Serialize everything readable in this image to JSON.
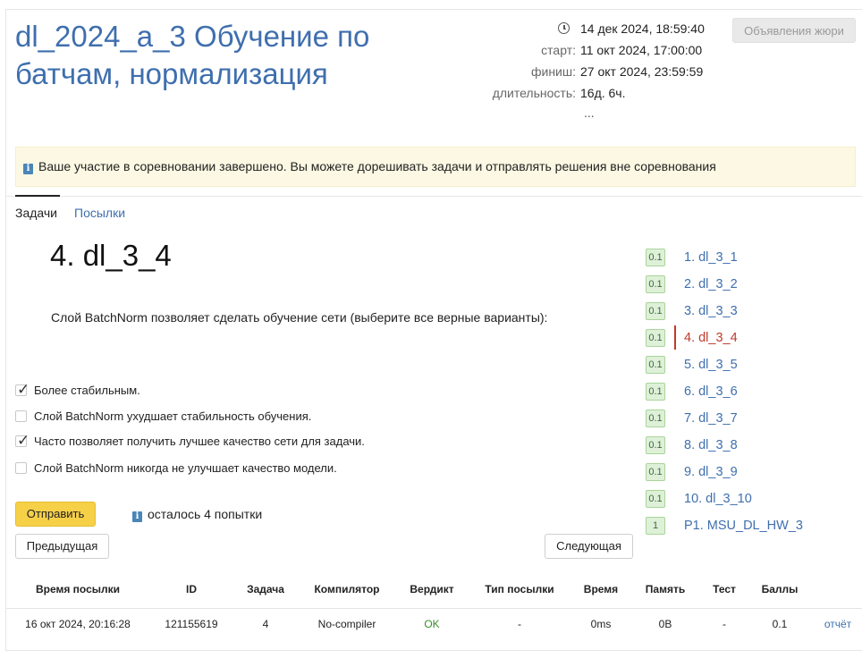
{
  "contest": {
    "title": "dl_2024_a_3 Обучение по батчам, нормализация",
    "current_time": "14 дек 2024, 18:59:40",
    "start_label": "старт:",
    "start_value": "11 окт 2024, 17:00:00",
    "finish_label": "финиш:",
    "finish_value": "27 окт 2024, 23:59:59",
    "duration_label": "длительность:",
    "duration_value": "16д. 6ч.",
    "more": "...",
    "jury_button": "Объявления жюри"
  },
  "notice": "Ваше участие в соревновании завершено. Вы можете дорешивать задачи и отправлять решения вне соревнования",
  "tabs": [
    {
      "label": "Задачи",
      "active": true
    },
    {
      "label": "Посылки",
      "active": false
    }
  ],
  "problem": {
    "title": "4. dl_3_4",
    "statement": "Слой BatchNorm позволяет сделать обучение сети (выберите все верные варианты):",
    "options": [
      {
        "label": "Более стабильным.",
        "checked": true
      },
      {
        "label": "Слой BatchNorm ухудшает стабильность обучения.",
        "checked": false
      },
      {
        "label": "Часто позволяет получить лучшее качество сети для задачи.",
        "checked": true
      },
      {
        "label": "Слой BatchNorm никогда не улучшает качество модели.",
        "checked": false
      }
    ],
    "submit_button": "Отправить",
    "attempts_left": "осталось 4 попытки",
    "prev_button": "Предыдущая",
    "next_button": "Следующая"
  },
  "task_list": [
    {
      "score": "0.1",
      "label": "1. dl_3_1",
      "current": false
    },
    {
      "score": "0.1",
      "label": "2. dl_3_2",
      "current": false
    },
    {
      "score": "0.1",
      "label": "3. dl_3_3",
      "current": false
    },
    {
      "score": "0.1",
      "label": "4. dl_3_4",
      "current": true
    },
    {
      "score": "0.1",
      "label": "5. dl_3_5",
      "current": false
    },
    {
      "score": "0.1",
      "label": "6. dl_3_6",
      "current": false
    },
    {
      "score": "0.1",
      "label": "7. dl_3_7",
      "current": false
    },
    {
      "score": "0.1",
      "label": "8. dl_3_8",
      "current": false
    },
    {
      "score": "0.1",
      "label": "9. dl_3_9",
      "current": false
    },
    {
      "score": "0.1",
      "label": "10. dl_3_10",
      "current": false
    },
    {
      "score": "1",
      "label": "P1. MSU_DL_HW_3",
      "current": false
    }
  ],
  "submissions": {
    "headers": [
      "Время посылки",
      "ID",
      "Задача",
      "Компилятор",
      "Вердикт",
      "Тип посылки",
      "Время",
      "Память",
      "Тест",
      "Баллы"
    ],
    "rows": [
      {
        "time": "16 окт 2024, 20:16:28",
        "id": "121155619",
        "task": "4",
        "compiler": "No-compiler",
        "verdict": "OK",
        "type": "-",
        "run_time": "0ms",
        "memory": "0B",
        "test": "-",
        "score": "0.1",
        "report": "отчёт"
      }
    ]
  },
  "colors": {
    "link": "#3f6fae",
    "current": "#c0392b",
    "ok": "#3a8c2a",
    "notice_bg": "#fcf8e3",
    "submit_bg": "#f6d047"
  }
}
